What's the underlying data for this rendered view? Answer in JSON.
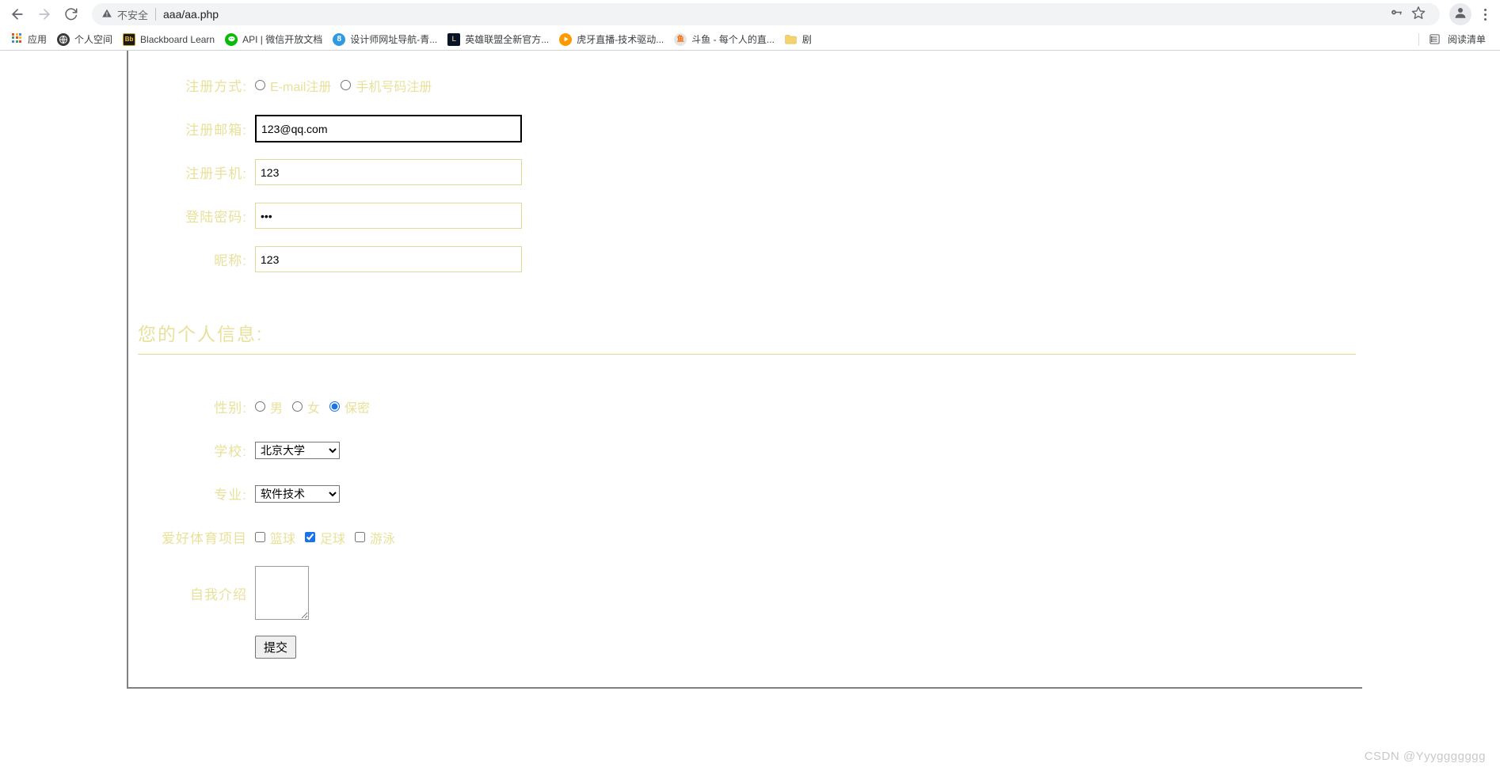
{
  "browser": {
    "back_icon": "back-arrow-icon",
    "forward_icon": "forward-arrow-icon",
    "reload_icon": "reload-icon",
    "security_warning_label": "不安全",
    "url": "aaa/aa.php",
    "password_key_icon": "key-icon",
    "bookmark_star_icon": "star-icon",
    "profile_icon": "profile-avatar-icon",
    "menu_icon": "three-dot-menu-icon",
    "bookmarks": [
      {
        "label": "应用",
        "icon": "apps-grid-icon"
      },
      {
        "label": "个人空间",
        "icon": "globe-icon"
      },
      {
        "label": "Blackboard Learn",
        "icon": "blackboard-bb-icon"
      },
      {
        "label": "API | 微信开放文档",
        "icon": "wechat-icon"
      },
      {
        "label": "设计师网址导航-青...",
        "icon": "number-8-icon"
      },
      {
        "label": "英雄联盟全新官方...",
        "icon": "lol-icon"
      },
      {
        "label": "虎牙直播-技术驱动...",
        "icon": "huya-icon"
      },
      {
        "label": "斗鱼 - 每个人的直...",
        "icon": "douyu-icon"
      },
      {
        "label": "剧",
        "icon": "folder-icon"
      }
    ],
    "reading_list_label": "阅读清单",
    "reading_list_icon": "reading-list-icon"
  },
  "form": {
    "register_method": {
      "label": "注册方式:",
      "options": [
        {
          "label": "E-mail注册",
          "checked": false
        },
        {
          "label": "手机号码注册",
          "checked": false
        }
      ]
    },
    "email": {
      "label": "注册邮箱:",
      "value": "123@qq.com",
      "placeholder": "",
      "focused": true
    },
    "phone": {
      "label": "注册手机:",
      "value": "123",
      "placeholder": ""
    },
    "password": {
      "label": "登陆密码:",
      "value": "123",
      "masked": "•••",
      "placeholder": ""
    },
    "nickname": {
      "label": "昵称:",
      "value": "123",
      "placeholder": ""
    },
    "personal_section_heading": "您的个人信息:",
    "gender": {
      "label": "性别:",
      "options": [
        {
          "label": "男",
          "checked": false
        },
        {
          "label": "女",
          "checked": false
        },
        {
          "label": "保密",
          "checked": true
        }
      ]
    },
    "school": {
      "label": "学校:",
      "selected": "北京大学",
      "options": [
        "北京大学"
      ]
    },
    "major": {
      "label": "专业:",
      "selected": "软件技术",
      "options": [
        "软件技术"
      ]
    },
    "sports": {
      "label": "爱好体育项目",
      "options": [
        {
          "label": "篮球",
          "checked": false
        },
        {
          "label": "足球",
          "checked": true
        },
        {
          "label": "游泳",
          "checked": false
        }
      ]
    },
    "intro": {
      "label": "自我介绍",
      "value": "",
      "placeholder": ""
    },
    "submit_label": "提交"
  },
  "watermark": "CSDN @Yyyggggggg",
  "colors": {
    "label_yellow": "#e8e19a",
    "input_border": "#e0da98",
    "accent_blue": "#1a73e8",
    "focus_black": "#000000"
  }
}
